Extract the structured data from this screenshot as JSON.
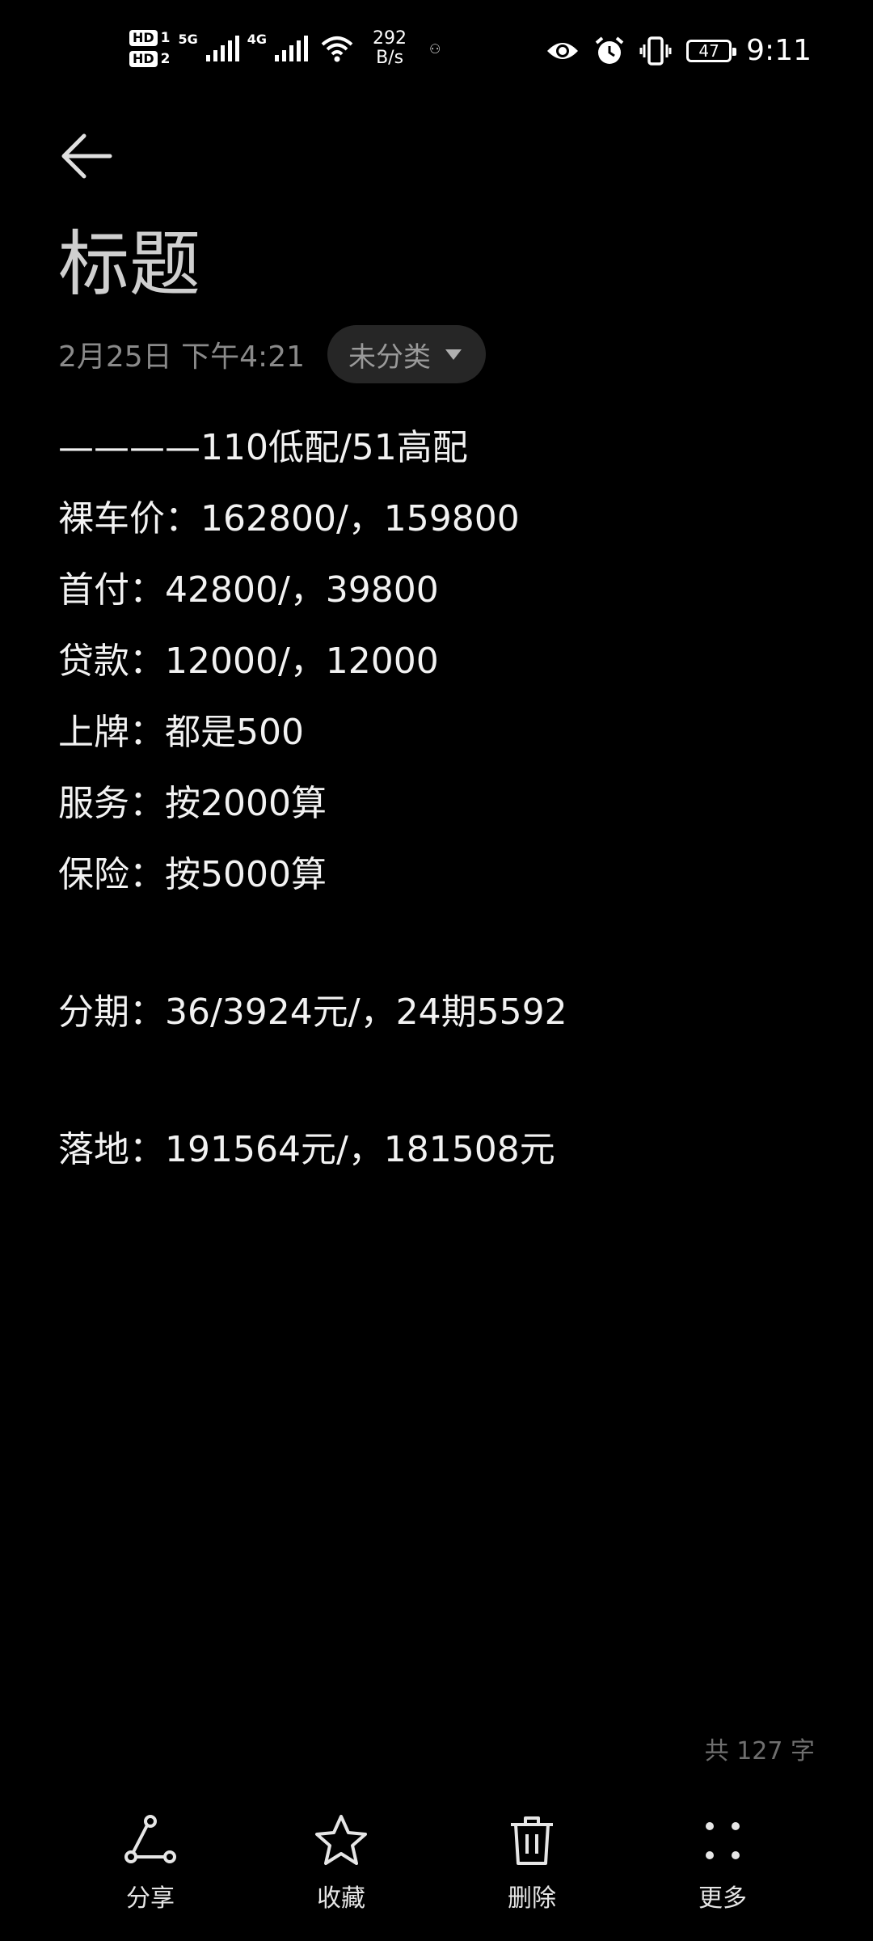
{
  "status_bar": {
    "hd1": "HD",
    "sim1": "1",
    "hd2": "HD",
    "sim2": "2",
    "net1": "5G",
    "net2": "4G",
    "speed_value": "292",
    "speed_unit": "B/s",
    "battery_level": "47",
    "time": "9:11",
    "icons": [
      "eye-icon",
      "alarm-icon",
      "vibrate-icon",
      "battery-icon"
    ]
  },
  "header": {
    "back_icon": "arrow-left-icon"
  },
  "note": {
    "title": "标题",
    "date": "2月25日 下午4:21",
    "category": "未分类",
    "lines": [
      "————110低配/51高配",
      "裸车价：162800/，159800",
      "首付：42800/，39800",
      "贷款：12000/，12000",
      "上牌：都是500",
      "服务：按2000算",
      "保险：按5000算",
      "",
      "分期：36/3924元/，24期5592",
      "",
      "落地：191564元/，181508元"
    ],
    "word_count": "共 127 字"
  },
  "toolbar": {
    "share": "分享",
    "favorite": "收藏",
    "delete": "删除",
    "more": "更多"
  },
  "colors": {
    "background": "#000000",
    "text": "#f2f2f2",
    "muted": "#8a8a8a",
    "chip_bg": "#262626"
  }
}
